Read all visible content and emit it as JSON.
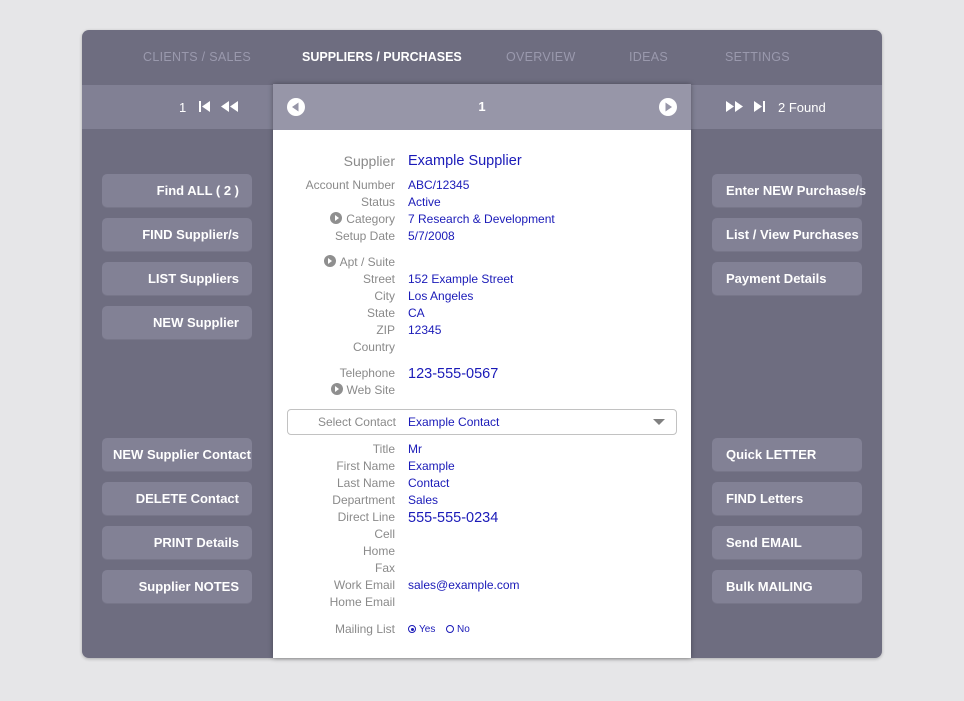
{
  "tabs": [
    "CLIENTS / SALES",
    "SUPPLIERS / PURCHASES",
    "OVERVIEW",
    "IDEAS",
    "SETTINGS"
  ],
  "active_tab": "SUPPLIERS / PURCHASES",
  "nav": {
    "left_record": "1",
    "record_number": "1",
    "found": "2 Found"
  },
  "supplier": {
    "labels": {
      "supplier": "Supplier",
      "account_number": "Account Number",
      "status": "Status",
      "category": "Category",
      "setup_date": "Setup Date",
      "apt_suite": "Apt / Suite",
      "street": "Street",
      "city": "City",
      "state": "State",
      "zip": "ZIP",
      "country": "Country",
      "telephone": "Telephone",
      "web_site": "Web Site"
    },
    "name": "Example Supplier",
    "account_number": "ABC/12345",
    "status": "Active",
    "category": "7 Research & Development",
    "setup_date": "5/7/2008",
    "street": "152 Example Street",
    "city": "Los Angeles",
    "state": "CA",
    "zip": "12345",
    "telephone": "123-555-0567"
  },
  "contact": {
    "select_label": "Select Contact",
    "selected": "Example Contact",
    "labels": {
      "title": "Title",
      "first_name": "First Name",
      "last_name": "Last Name",
      "department": "Department",
      "direct_line": "Direct Line",
      "cell": "Cell",
      "home": "Home",
      "fax": "Fax",
      "work_email": "Work Email",
      "home_email": "Home Email",
      "mailing_list": "Mailing List"
    },
    "title": "Mr",
    "first_name": "Example",
    "last_name": "Contact",
    "department": "Sales",
    "direct_line": "555-555-0234",
    "work_email": "sales@example.com",
    "mailing_yes": "Yes",
    "mailing_no": "No",
    "mailing_selected": "Yes"
  },
  "left_buttons": {
    "find_all": "Find ALL  ( 2 )",
    "find_suppliers": "FIND Supplier/s",
    "list_suppliers": "LIST Suppliers",
    "new_supplier": "NEW Supplier",
    "new_supplier_contact": "NEW Supplier Contact",
    "delete_contact": "DELETE Contact",
    "print_details": "PRINT Details",
    "supplier_notes": "Supplier NOTES"
  },
  "right_buttons": {
    "enter_new_purchase": "Enter NEW Purchase/s",
    "list_view_purchases": "List / View Purchases",
    "payment_details": "Payment Details",
    "quick_letter": "Quick LETTER",
    "find_letters": "FIND Letters",
    "send_email": "Send EMAIL",
    "bulk_mailing": "Bulk MAILING"
  },
  "colors": {
    "frame": "#6e6d80",
    "nav_band": "#818094",
    "panel_header": "#9796a8",
    "button": "#828195",
    "value_text": "#1a1ab8",
    "label_text": "#8a8a8a"
  },
  "icons": [
    "first-record-icon",
    "rewind-icon",
    "prev-record-icon",
    "next-record-icon",
    "fast-forward-icon",
    "last-record-icon",
    "dropdown-caret-icon",
    "field-arrow-icon"
  ]
}
